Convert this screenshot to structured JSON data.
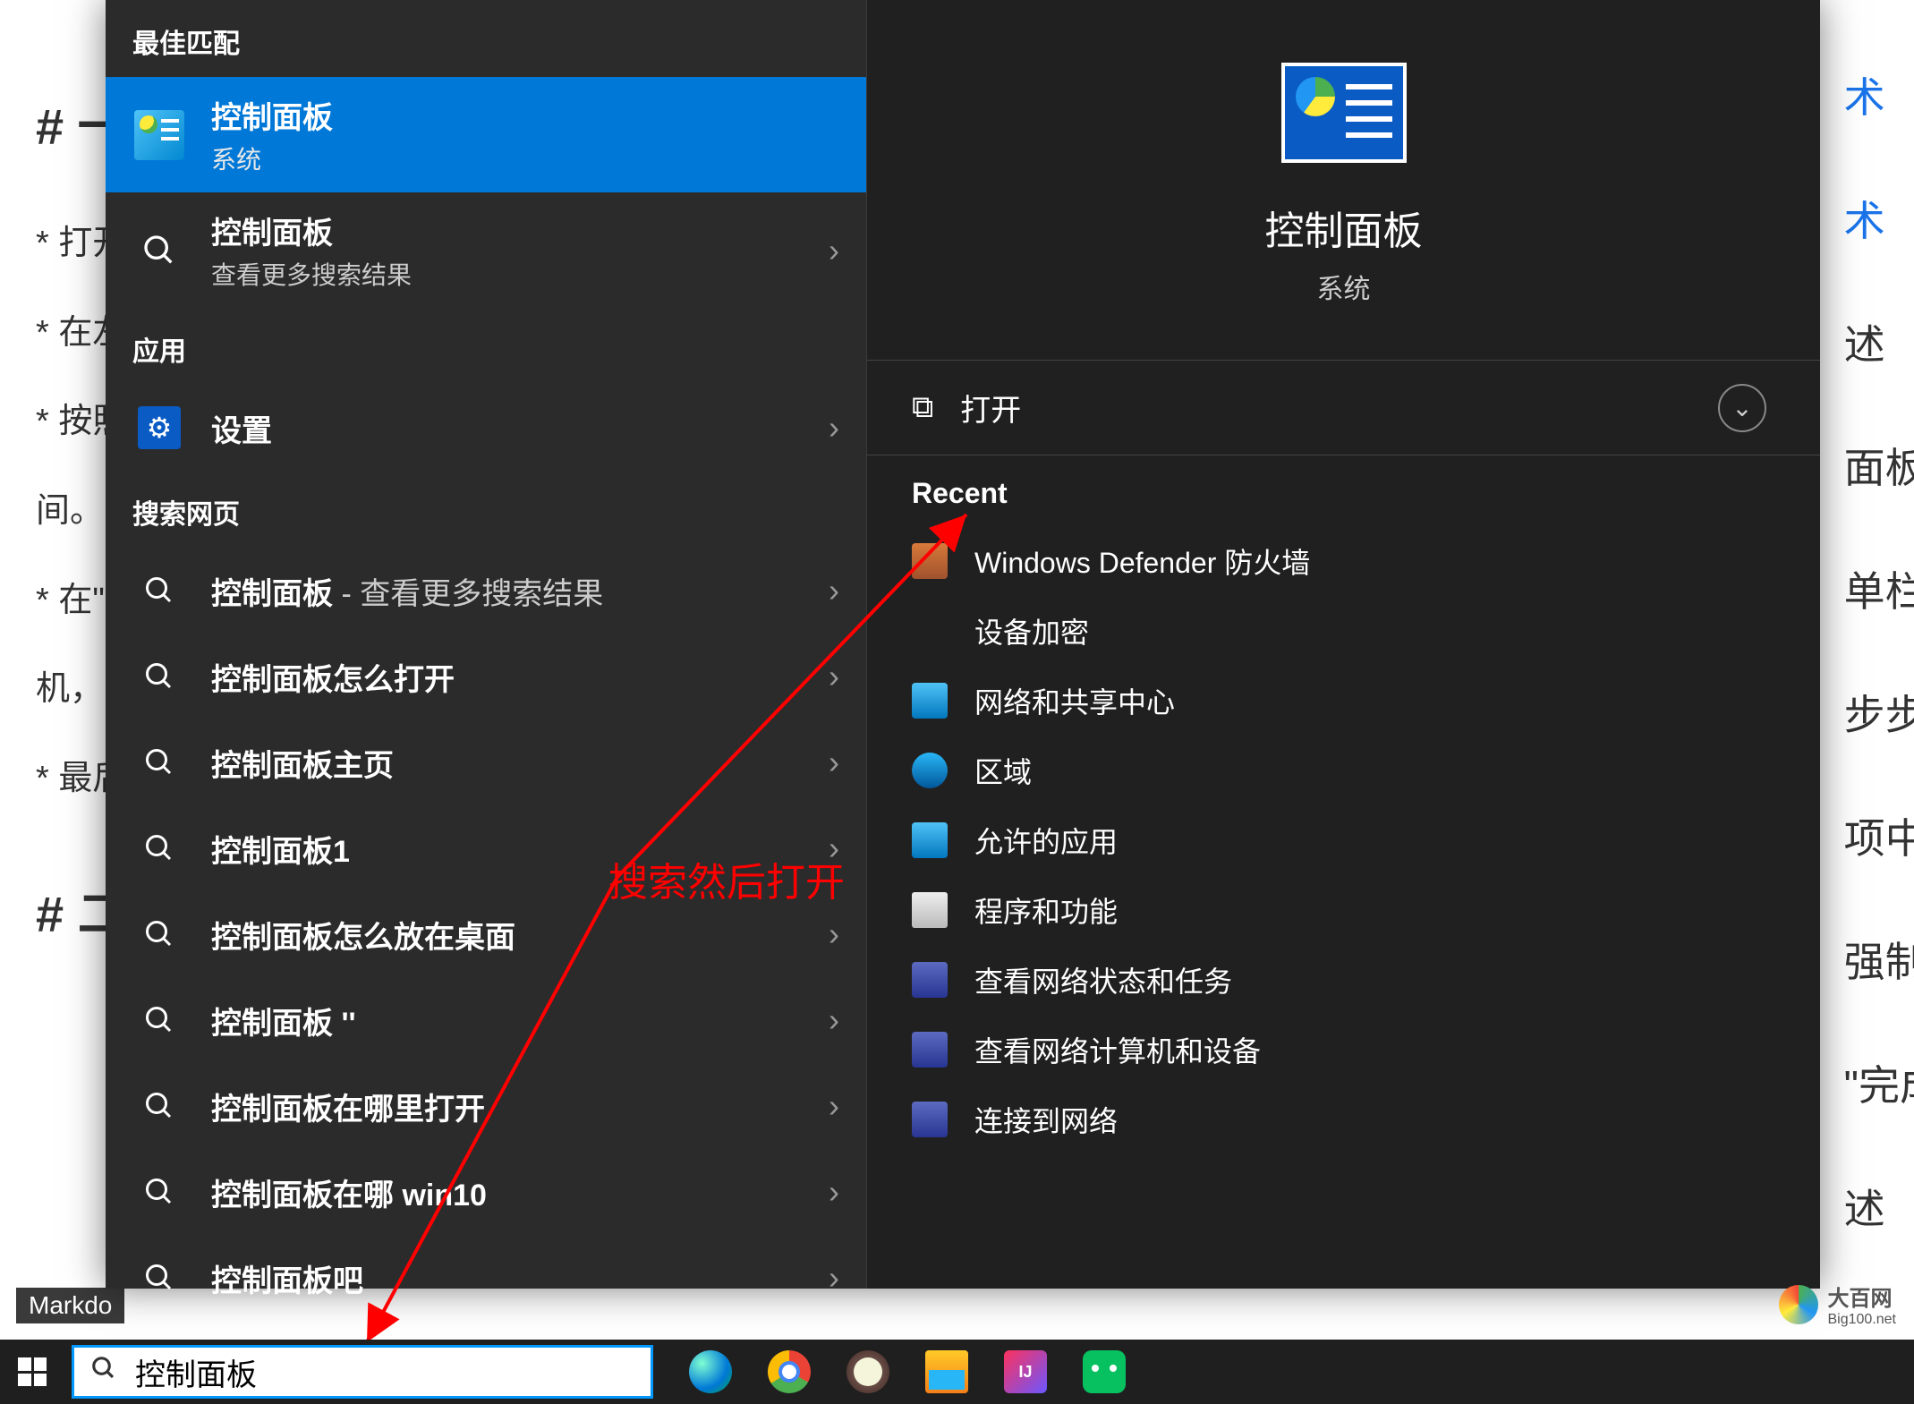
{
  "bg_doc": {
    "head1": "# 一",
    "li1": "* 打开",
    "li2": "* 在左",
    "li3": "* 按照",
    "li4": "间。",
    "li5": "* 在\"",
    "li6": "机，",
    "li7": "* 最后",
    "head2": "# 二",
    "right": [
      "术",
      "术",
      "述",
      "面板\"",
      "单栏",
      "步步",
      "项中",
      "强制",
      "\"完成",
      "述"
    ]
  },
  "bg_tab": "Markdo",
  "left_panel": {
    "best_match_header": "最佳匹配",
    "selected": {
      "title": "控制面板",
      "sub": "系统"
    },
    "more_results": {
      "title": "控制面板",
      "sub": "查看更多搜索结果"
    },
    "apps_header": "应用",
    "settings": "设置",
    "web_header": "搜索网页",
    "web_items": [
      {
        "prefix": "控制面板",
        "suffix": " - 查看更多搜索结果"
      },
      {
        "prefix": "控制面板",
        "bold": "怎么打开"
      },
      {
        "prefix": "控制面板",
        "bold": "主页"
      },
      {
        "prefix": "控制面板",
        "bold": "1"
      },
      {
        "prefix": "控制面板",
        "bold": "怎么放在桌面"
      },
      {
        "prefix": "控制面板",
        "bold": " ''"
      },
      {
        "prefix": "控制面板",
        "bold": "在哪里打开"
      },
      {
        "prefix": "控制面板",
        "bold": "在哪 win10"
      },
      {
        "prefix": "控制面板",
        "bold": "吧"
      }
    ]
  },
  "right_panel": {
    "title": "控制面板",
    "sub": "系统",
    "open_action": "打开",
    "recent_header": "Recent",
    "recent": [
      "Windows Defender 防火墙",
      "设备加密",
      "网络和共享中心",
      "区域",
      "允许的应用",
      "程序和功能",
      "查看网络状态和任务",
      "查看网络计算机和设备",
      "连接到网络"
    ]
  },
  "search": {
    "value": "控制面板"
  },
  "annotation": "搜索然后打开",
  "watermark": {
    "name": "大百网",
    "sub": "Big100.net"
  },
  "ij_label": "IJ"
}
